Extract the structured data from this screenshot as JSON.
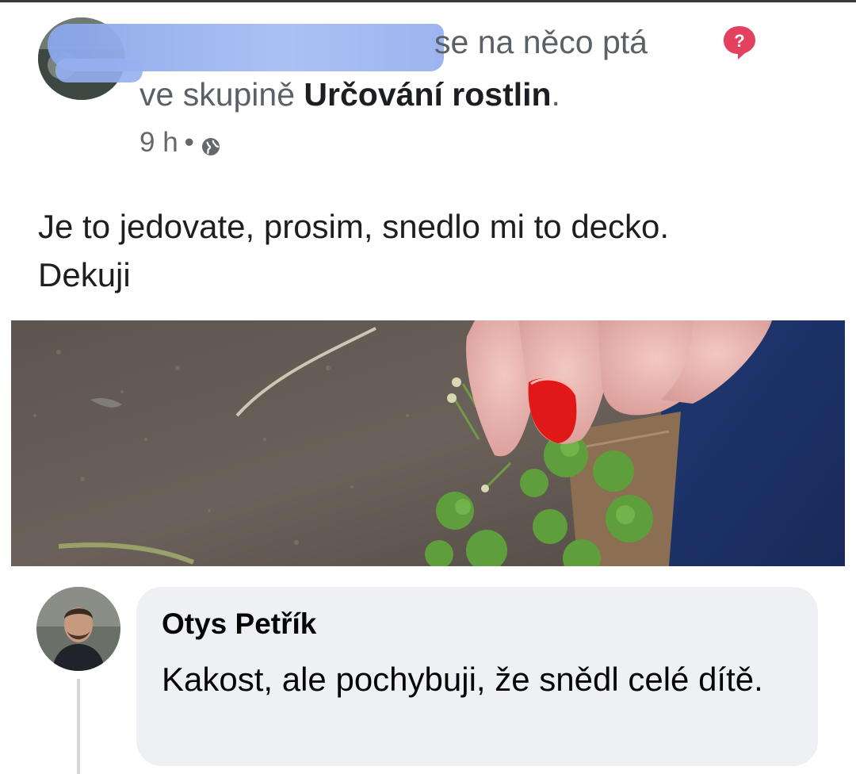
{
  "post": {
    "action_text": "se na něco ptá",
    "group_prefix": "ve skupině",
    "group_name": "Určování rostlin",
    "group_suffix": ".",
    "time": "9 h",
    "separator": "•",
    "privacy_icon": "globe-icon",
    "question_badge_icon": "question-bubble-icon",
    "body": "Je to jedovate, prosim, snedlo mi to decko. Dekuji"
  },
  "comment": {
    "author": "Otys Petřík",
    "text": "Kakost, ale pochybuji, že snědl celé dítě."
  },
  "colors": {
    "nail_red": "#e01818",
    "question_badge": "#e4405f",
    "bubble_bg": "#eef0f3"
  }
}
